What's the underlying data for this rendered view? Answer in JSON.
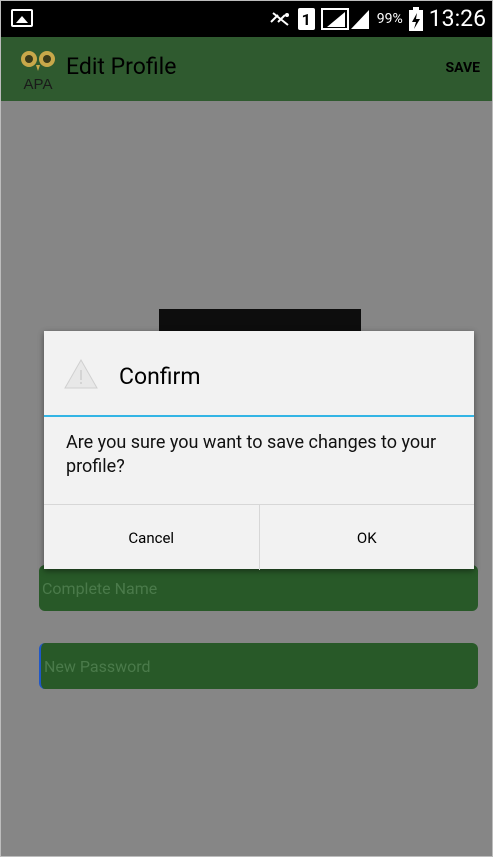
{
  "status_bar": {
    "battery_percent": "99%",
    "time": "13:26",
    "sim_label": "1"
  },
  "action_bar": {
    "logo_text": "APA",
    "title": "Edit Profile",
    "save_label": "SAVE"
  },
  "form": {
    "name_placeholder": "Complete Name",
    "password_placeholder": "New Password"
  },
  "dialog": {
    "title": "Confirm",
    "message": "Are you sure you want to save changes to your profile?",
    "cancel_label": "Cancel",
    "ok_label": "OK"
  },
  "colors": {
    "accent": "#33b5e5",
    "action_bar": "#2f5a2f",
    "field_bg": "#285928"
  },
  "icons": [
    "image-icon",
    "mute-icon",
    "sim-icon",
    "signal-icon",
    "battery-icon",
    "owl-logo-icon",
    "warning-icon"
  ]
}
